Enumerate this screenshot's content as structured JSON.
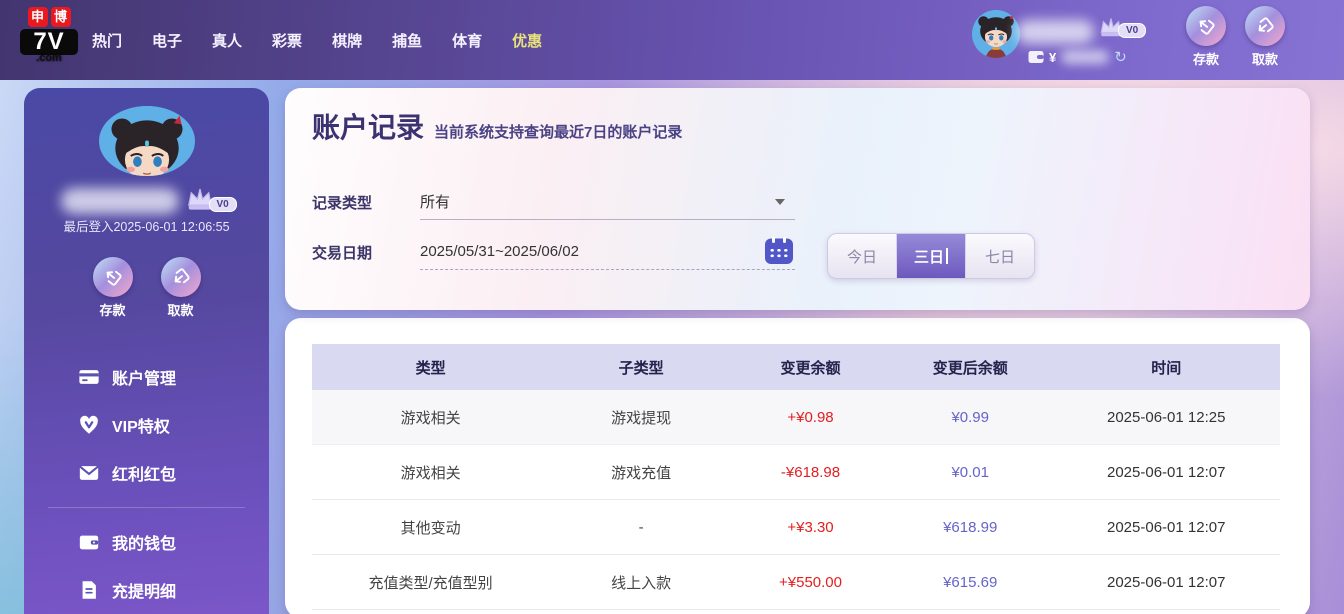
{
  "nav": {
    "logo": {
      "badge1": "申",
      "badge2": "博",
      "brand": "7V",
      "domain": ".com"
    },
    "items": [
      {
        "label": "热门"
      },
      {
        "label": "电子"
      },
      {
        "label": "真人"
      },
      {
        "label": "彩票"
      },
      {
        "label": "棋牌"
      },
      {
        "label": "捕鱼"
      },
      {
        "label": "体育"
      },
      {
        "label": "优惠"
      }
    ],
    "active_item": "优惠",
    "vip_badge": "V0",
    "currency_symbol": "¥",
    "refresh_icon_glyph": "↻",
    "deposit_label": "存款",
    "withdraw_label": "取款"
  },
  "sidebar": {
    "vip_badge": "V0",
    "last_login": "最后登入2025-06-01 12:06:55",
    "deposit_label": "存款",
    "withdraw_label": "取款",
    "menu": [
      {
        "label": "账户管理",
        "icon": "bank-card-icon"
      },
      {
        "label": "VIP特权",
        "icon": "vip-badge-icon"
      },
      {
        "label": "红利红包",
        "icon": "red-packet-icon"
      },
      {
        "label": "我的钱包",
        "icon": "wallet-icon"
      },
      {
        "label": "充提明细",
        "icon": "document-icon"
      }
    ]
  },
  "main": {
    "title": "账户记录",
    "subtitle": "当前系统支持查询最近7日的账户记录",
    "filters": {
      "record_type_label": "记录类型",
      "record_type_value": "所有",
      "date_label": "交易日期",
      "date_value": "2025/05/31~2025/06/02",
      "ranges": [
        {
          "label": "今日"
        },
        {
          "label": "三日"
        },
        {
          "label": "七日"
        }
      ],
      "active_range": "三日"
    },
    "table": {
      "headers": [
        "类型",
        "子类型",
        "变更余额",
        "变更后余额",
        "时间"
      ],
      "rows": [
        {
          "type": "游戏相关",
          "subtype": "游戏提现",
          "change": "+¥0.98",
          "balance": "¥0.99",
          "time": "2025-06-01 12:25"
        },
        {
          "type": "游戏相关",
          "subtype": "游戏充值",
          "change": "-¥618.98",
          "balance": "¥0.01",
          "time": "2025-06-01 12:07"
        },
        {
          "type": "其他变动",
          "subtype": "-",
          "change": "+¥3.30",
          "balance": "¥618.99",
          "time": "2025-06-01 12:07"
        },
        {
          "type": "充值类型/充值型别",
          "subtype": "线上入款",
          "change": "+¥550.00",
          "balance": "¥615.69",
          "time": "2025-06-01 12:07"
        }
      ]
    }
  },
  "colors": {
    "change_amount": "#e41e1e",
    "balance_amount": "#6663c9",
    "nav_active": "#e9e27b",
    "accent_purple": "#6d59be",
    "table_header_bg": "#d9d9f2"
  }
}
